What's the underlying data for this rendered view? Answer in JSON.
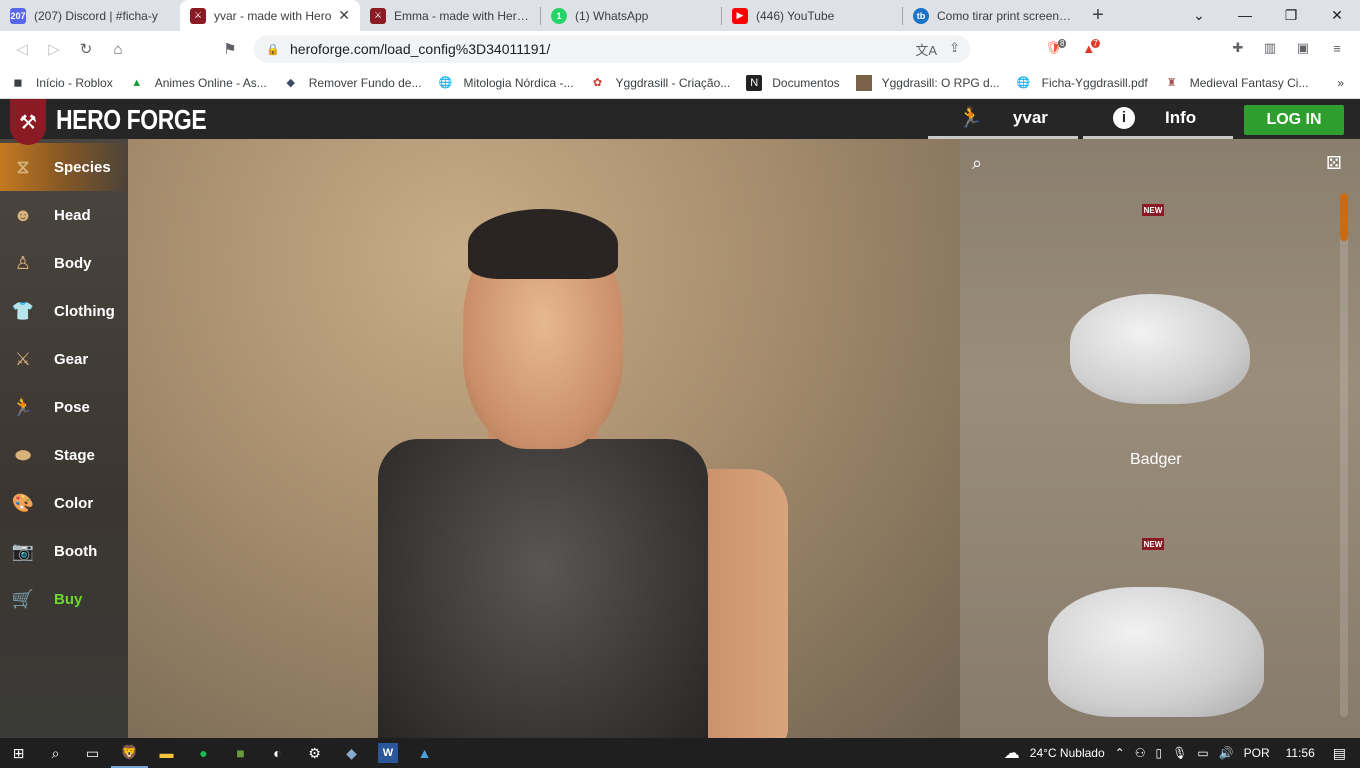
{
  "browser": {
    "tabs": [
      {
        "title": "(207) Discord | #ficha-y",
        "icon": "discord-icon",
        "badge": "207",
        "color": "#5865f2",
        "active": false
      },
      {
        "title": "yvar - made with Hero",
        "icon": "heroforge-icon",
        "color": "#8a1a24",
        "active": true
      },
      {
        "title": "Emma - made with Hero Fo",
        "icon": "heroforge-icon",
        "color": "#8a1a24",
        "active": false
      },
      {
        "title": "(1) WhatsApp",
        "icon": "whatsapp-icon",
        "badge": "1",
        "color": "#25d366",
        "active": false
      },
      {
        "title": "(446) YouTube",
        "icon": "youtube-icon",
        "color": "#ff0000",
        "active": false
      },
      {
        "title": "Como tirar print screen no",
        "icon": "tb-icon",
        "color": "#1a73c9",
        "active": false
      }
    ],
    "new_tab": "+",
    "window_controls": {
      "tab_search": "⌄",
      "minimize": "—",
      "maximize": "❐",
      "close": "✕"
    },
    "url": "heroforge.com/load_config%3D34011191/",
    "extensions": {
      "brave_count": "8",
      "rewards_count": "7"
    },
    "bookmarks": [
      {
        "label": "Início - Roblox",
        "icon": "roblox-icon"
      },
      {
        "label": "Animes Online - As...",
        "icon": "animes-icon"
      },
      {
        "label": "Remover Fundo de...",
        "icon": "remover-icon"
      },
      {
        "label": "Mitologia Nórdica -...",
        "icon": "globe-icon"
      },
      {
        "label": "Yggdrasill - Criação...",
        "icon": "ygg-icon"
      },
      {
        "label": "Documentos",
        "icon": "notion-icon"
      },
      {
        "label": "Yggdrasill: O RPG d...",
        "icon": "rpg-icon"
      },
      {
        "label": "Ficha-Yggdrasill.pdf",
        "icon": "globe-icon"
      },
      {
        "label": "Medieval Fantasy Ci...",
        "icon": "castle-icon"
      }
    ],
    "bookmarks_more": "»"
  },
  "heroforge": {
    "brand": "HERO FORGE",
    "nav": {
      "character": "yvar",
      "info": "Info",
      "login": "LOG IN"
    },
    "sidebar": [
      {
        "label": "Species",
        "icon": "dna-icon",
        "active": true
      },
      {
        "label": "Head",
        "icon": "head-icon"
      },
      {
        "label": "Body",
        "icon": "body-icon"
      },
      {
        "label": "Clothing",
        "icon": "shirt-icon"
      },
      {
        "label": "Gear",
        "icon": "axes-icon"
      },
      {
        "label": "Pose",
        "icon": "pose-icon"
      },
      {
        "label": "Stage",
        "icon": "stage-icon"
      },
      {
        "label": "Color",
        "icon": "palette-icon"
      },
      {
        "label": "Booth",
        "icon": "camera-icon"
      },
      {
        "label": "Buy",
        "icon": "cart-icon"
      }
    ],
    "browser_panel": {
      "items": [
        {
          "label": "Badger",
          "badge": "NEW"
        },
        {
          "label": "",
          "badge": "NEW"
        }
      ]
    }
  },
  "taskbar": {
    "weather": "24°C  Nublado",
    "language": "POR",
    "time": "11:56"
  }
}
